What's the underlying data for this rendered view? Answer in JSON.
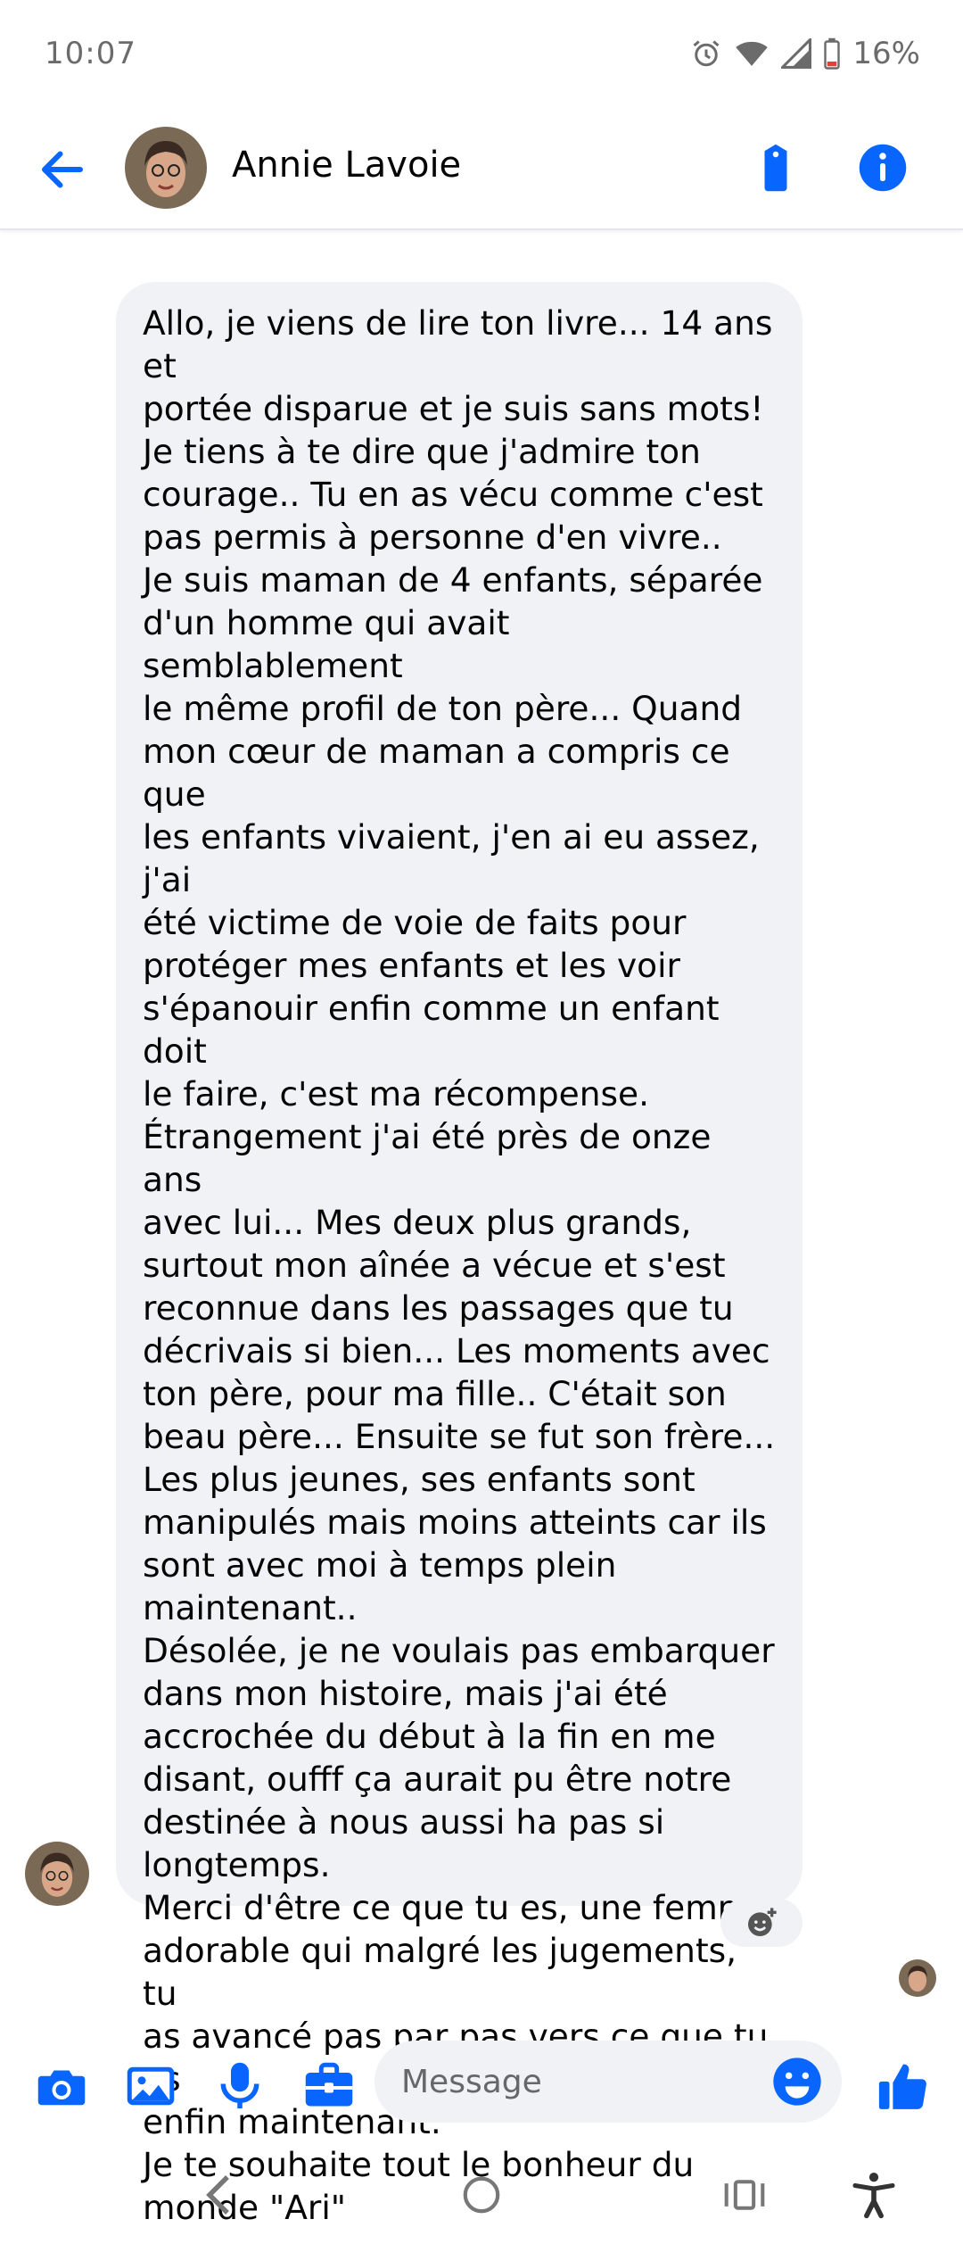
{
  "status_bar": {
    "time": "10:07",
    "battery": "16%",
    "icons": [
      "alarm-icon",
      "wifi-icon",
      "signal-icon",
      "battery-icon"
    ]
  },
  "header": {
    "contact_name": "Annie Lavoie",
    "back_icon": "arrow-left-icon",
    "tag_icon": "tag-icon",
    "info_icon": "info-icon"
  },
  "thread": {
    "message": "Allo, je viens de lire ton livre... 14 ans et\nportée disparue et je suis sans mots!\nJe tiens à te dire que j'admire ton\ncourage.. Tu en as vécu comme c'est\npas permis à personne d'en vivre..\nJe suis maman de 4 enfants, séparée\nd'un homme qui avait semblablement\nle même profil de ton père... Quand\nmon cœur de maman a compris ce que\nles enfants vivaient, j'en ai eu assez, j'ai\nété victime de voie de faits pour\nprotéger mes enfants et les voir\ns'épanouir enfin comme un enfant doit\nle faire, c'est ma récompense.\nÉtrangement j'ai été près de onze ans\navec lui... Mes deux plus grands,\nsurtout mon aînée a vécue et s'est\nreconnue dans les passages que tu\ndécrivais si bien... Les moments avec\nton père, pour ma fille.. C'était son\nbeau père... Ensuite se fut son frère...\nLes plus jeunes, ses enfants sont\nmanipulés mais moins atteints car ils\nsont avec moi à temps plein\nmaintenant..\nDésolée, je ne voulais pas embarquer\ndans mon histoire, mais j'ai été\naccrochée du début à la fin en me\ndisant, oufff ça aurait pu être notre\ndestinée à nous aussi ha pas si\nlongtemps.\nMerci d'être ce que tu es, une femme\nadorable qui malgré les jugements, tu\nas avancé pas par pas vers ce que tu es\nenfin maintenant.\nJe te souhaite tout le bonheur du\nmonde \"Ari\"",
    "bubble_color": "#f0f2f5"
  },
  "composer": {
    "placeholder": "Message",
    "value": "",
    "icons": [
      "camera-icon",
      "image-icon",
      "microphone-icon",
      "briefcase-icon",
      "emoji-icon",
      "thumbs-up-icon"
    ]
  },
  "navbar": {
    "icons": [
      "back-nav-icon",
      "home-nav-icon",
      "recents-nav-icon",
      "accessibility-icon"
    ]
  },
  "colors": {
    "accent": "#0866ff",
    "text": "#050505",
    "muted": "#65676b"
  }
}
